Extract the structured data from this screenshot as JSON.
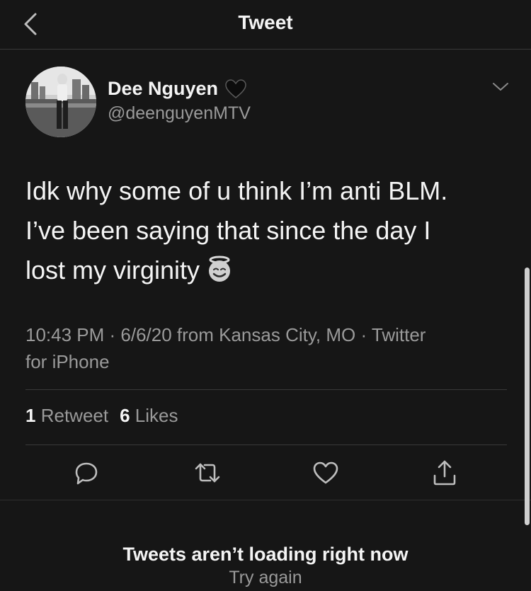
{
  "header": {
    "title": "Tweet",
    "back_icon": "chevron-left-icon"
  },
  "tweet": {
    "author_name": "Dee Nguyen",
    "author_badge_icon": "black-heart-icon",
    "author_handle": "@deenguyenMTV",
    "menu_icon": "chevron-down-icon",
    "text_lines": [
      "Idk why some of u think I’m anti BLM.",
      "I’ve been saying that since the day I",
      "lost my virginity"
    ],
    "text_emoji_icon": "smiling-face-with-halo-icon",
    "meta_line1": "10:43 PM · 6/6/20 from Kansas City, MO · Twitter",
    "meta_line2": "for iPhone",
    "retweet_count": "1",
    "retweet_label": "Retweet",
    "like_count": "6",
    "like_label": "Likes"
  },
  "actions": [
    "reply-icon",
    "retweet-icon",
    "like-icon",
    "share-icon"
  ],
  "error": {
    "message": "Tweets aren’t loading right now",
    "retry_label": "Try again"
  }
}
